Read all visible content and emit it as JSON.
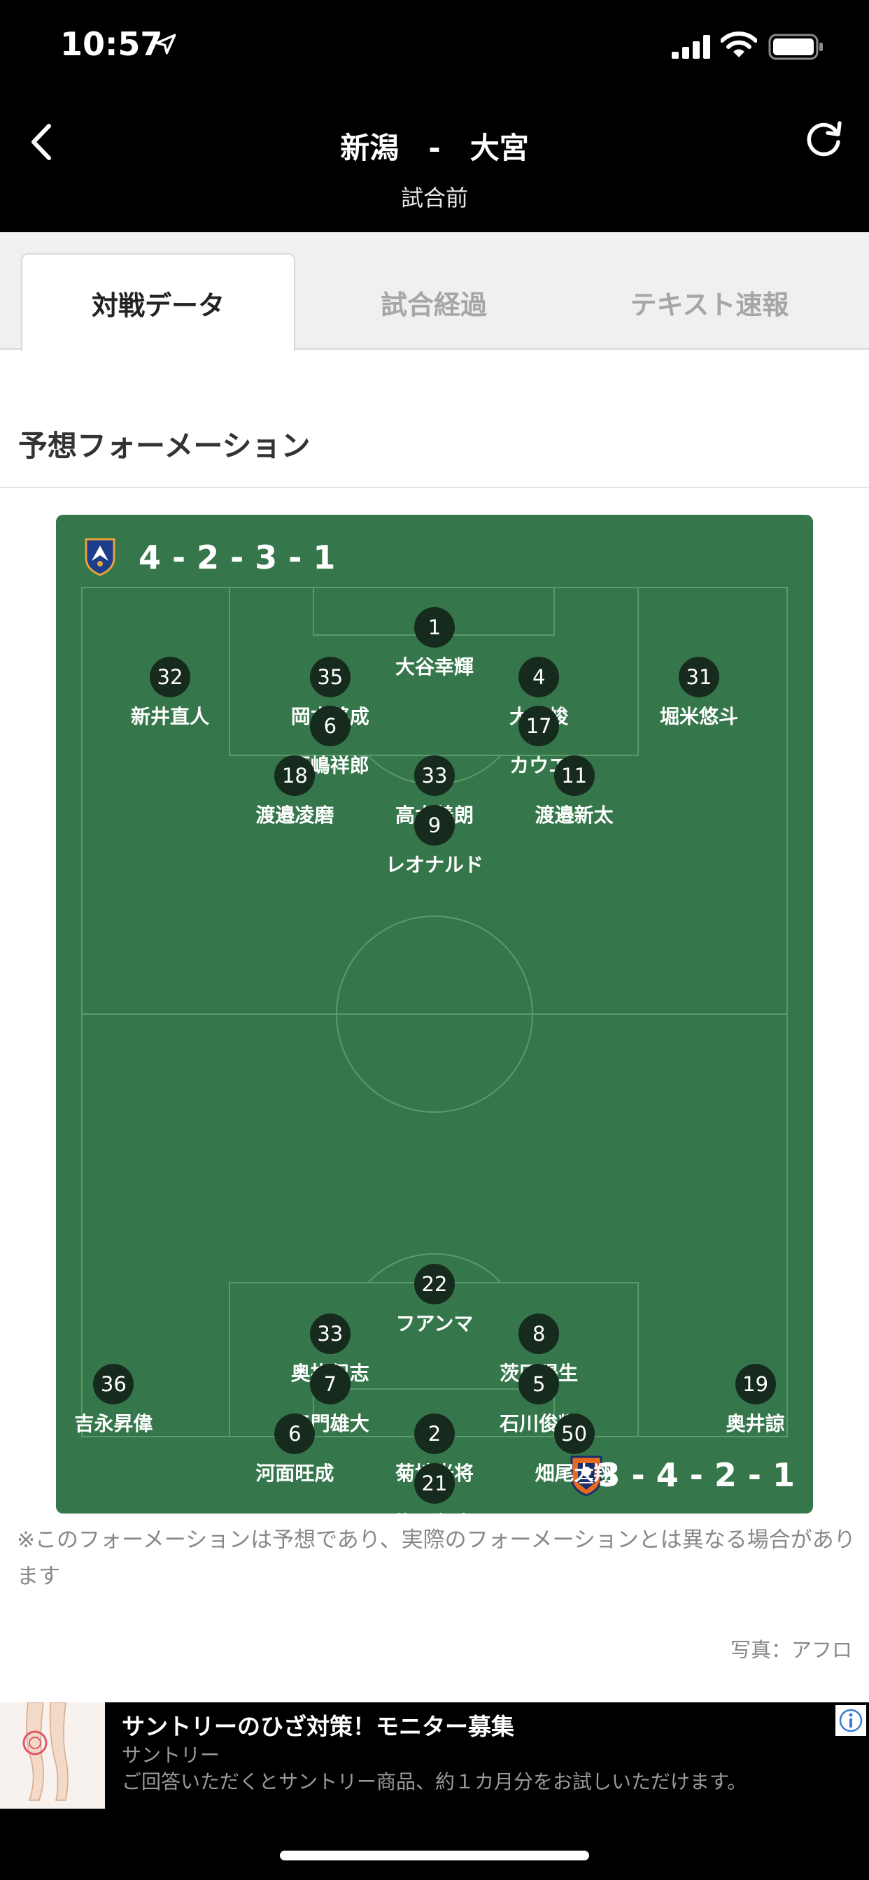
{
  "status_bar": {
    "time": "10:57",
    "icons": [
      "location-arrow-icon",
      "cellular-signal-icon",
      "wifi-icon",
      "battery-icon"
    ]
  },
  "nav": {
    "title": "新潟　-　大宮",
    "subtitle": "試合前",
    "back_icon": "chevron-left-icon",
    "refresh_icon": "refresh-icon"
  },
  "tabs": [
    {
      "label": "対戦データ",
      "active": true
    },
    {
      "label": "試合経過",
      "active": false
    },
    {
      "label": "テキスト速報",
      "active": false
    }
  ],
  "section": {
    "title": "予想フォーメーション"
  },
  "formation": {
    "pitch_color": "#35774b",
    "home": {
      "formation": "4 - 2 - 3 - 1",
      "emblem": "albirex-niigata-emblem",
      "players": [
        {
          "number": "1",
          "name": "大谷幸輝",
          "line": 1,
          "slot": 1,
          "of": 1
        },
        {
          "number": "32",
          "name": "新井直人",
          "line": 2,
          "slot": 1,
          "of": 4
        },
        {
          "number": "35",
          "name": "岡本將成",
          "line": 2,
          "slot": 2,
          "of": 4
        },
        {
          "number": "4",
          "name": "大武峻",
          "line": 2,
          "slot": 3,
          "of": 4
        },
        {
          "number": "31",
          "name": "堀米悠斗",
          "line": 2,
          "slot": 4,
          "of": 4
        },
        {
          "number": "6",
          "name": "戸嶋祥郎",
          "line": 3,
          "slot": 1,
          "of": 2
        },
        {
          "number": "17",
          "name": "カウエ",
          "line": 3,
          "slot": 2,
          "of": 2
        },
        {
          "number": "18",
          "name": "渡邉凌磨",
          "line": 4,
          "slot": 1,
          "of": 3
        },
        {
          "number": "33",
          "name": "高木善朗",
          "line": 4,
          "slot": 2,
          "of": 3
        },
        {
          "number": "11",
          "name": "渡邉新太",
          "line": 4,
          "slot": 3,
          "of": 3
        },
        {
          "number": "9",
          "name": "レオナルド",
          "line": 5,
          "slot": 1,
          "of": 1
        }
      ]
    },
    "away": {
      "formation": "3 - 4 - 2 - 1",
      "emblem": "omiya-ardija-emblem",
      "players": [
        {
          "number": "22",
          "name": "フアンマ",
          "line": 5,
          "slot": 1,
          "of": 1
        },
        {
          "number": "33",
          "name": "奥抜侃志",
          "line": 4,
          "slot": 1,
          "of": 2
        },
        {
          "number": "8",
          "name": "茨田陽生",
          "line": 4,
          "slot": 2,
          "of": 2
        },
        {
          "number": "36",
          "name": "吉永昇偉",
          "line": 3,
          "slot": 1,
          "of": 4
        },
        {
          "number": "7",
          "name": "三門雄大",
          "line": 3,
          "slot": 2,
          "of": 4
        },
        {
          "number": "5",
          "name": "石川俊輝",
          "line": 3,
          "slot": 3,
          "of": 4
        },
        {
          "number": "19",
          "name": "奥井諒",
          "line": 3,
          "slot": 4,
          "of": 4
        },
        {
          "number": "6",
          "name": "河面旺成",
          "line": 2,
          "slot": 1,
          "of": 3
        },
        {
          "number": "2",
          "name": "菊地光将",
          "line": 2,
          "slot": 2,
          "of": 3
        },
        {
          "number": "50",
          "name": "畑尾大翔",
          "line": 2,
          "slot": 3,
          "of": 3
        },
        {
          "number": "21",
          "name": "塩田仁史",
          "line": 1,
          "slot": 1,
          "of": 1
        }
      ]
    }
  },
  "disclaimer": "※このフォーメーションは予想であり、実際のフォーメーションとは異なる場合があります",
  "photo_credit": "写真：アフロ",
  "ad": {
    "title": "サントリーのひざ対策！モニター募集",
    "sponsor": "サントリー",
    "body": "ご回答いただくとサントリー商品、約１カ月分をお試しいただけます。",
    "info_icon": "ad-info-icon"
  }
}
